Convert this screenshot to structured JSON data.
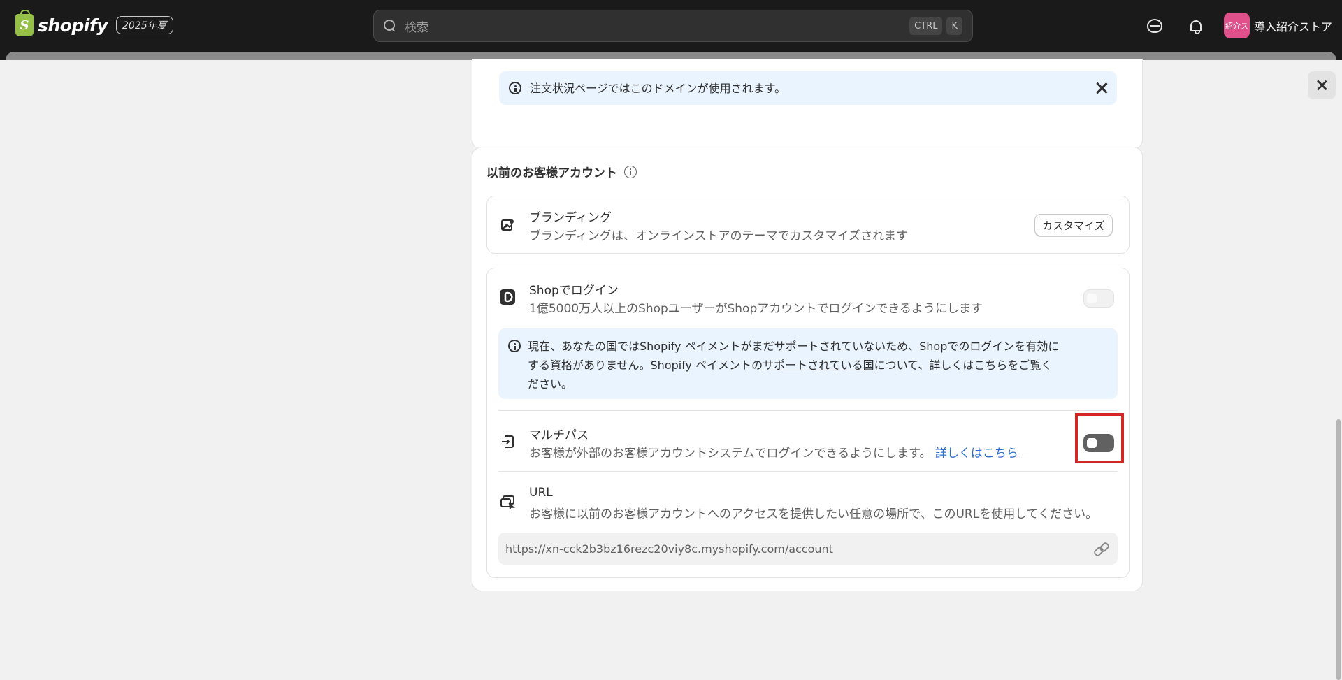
{
  "topbar": {
    "logo_text": "shopify",
    "edition_badge": "2025年夏",
    "search_placeholder": "検索",
    "shortcut_ctrl": "CTRL",
    "shortcut_k": "K",
    "store_avatar": "紹介ス",
    "store_name": "導入紹介ストア"
  },
  "domain_card": {
    "banner_text": "注文状況ページではこのドメインが使用されます。"
  },
  "legacy_accounts": {
    "title": "以前のお客様アカウント",
    "branding": {
      "title": "ブランディング",
      "description": "ブランディングは、オンラインストアのテーマでカスタマイズされます",
      "button_label": "カスタマイズ"
    },
    "shop_login": {
      "title": "Shopでログイン",
      "description": "1億5000万人以上のShopユーザーがShopアカウントでログインできるようにします",
      "toggle_state": "disabled",
      "banner_line1": "現在、あなたの国ではShopify ペイメントがまだサポートされていないため、Shopでのログインを有効に",
      "banner_line2_before": "する資格がありません。Shopify ペイメントの",
      "banner_link": "サポートされている国",
      "banner_line2_after": "について、詳しくはこちらをご覧く",
      "banner_line3": "ださい。"
    },
    "multipass": {
      "title": "マルチパス",
      "description": "お客様が外部のお客様アカウントシステムでログインできるようにします。",
      "learn_more": "詳しくはこちら",
      "toggle_state": "off"
    },
    "url": {
      "title": "URL",
      "description": "お客様に以前のお客様アカウントへのアクセスを提供したい任意の場所で、このURLを使用してください。",
      "value": "https://xn-cck2b3bz16rezc20viy8c.myshopify.com/account"
    }
  }
}
